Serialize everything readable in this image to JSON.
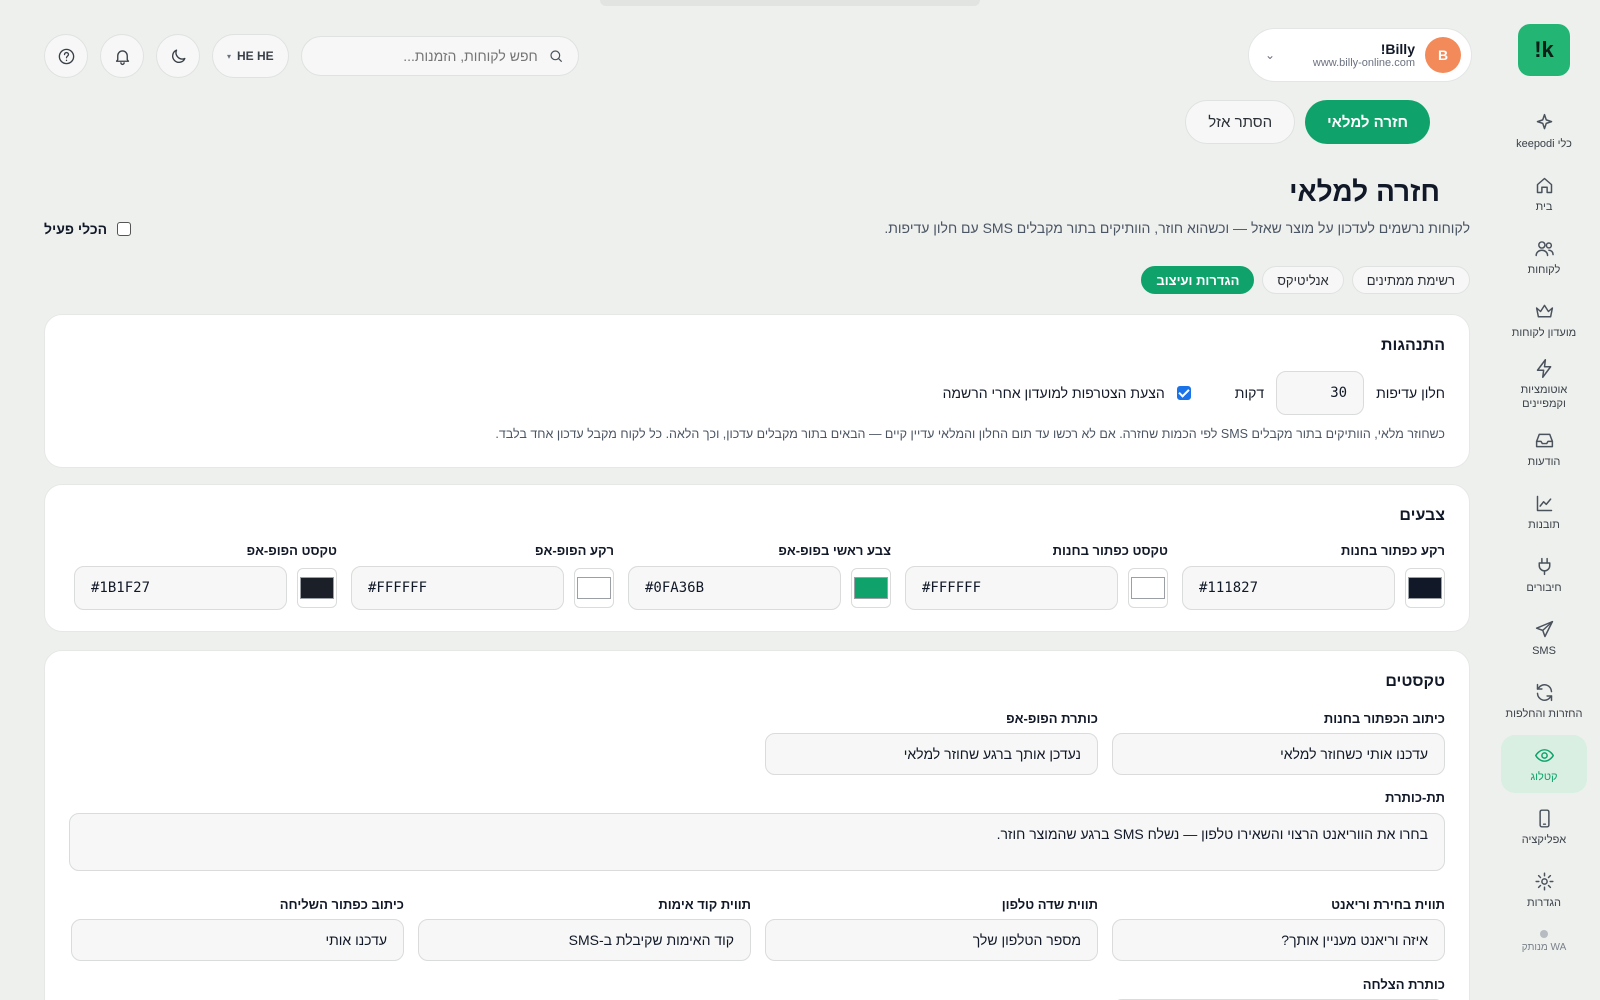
{
  "brand": {
    "logo_text": "!k"
  },
  "sidebar": {
    "items": [
      {
        "label": "כלי keepodi",
        "icon": "sparkle-icon"
      },
      {
        "label": "בית",
        "icon": "home-icon"
      },
      {
        "label": "לקוחות",
        "icon": "users-icon"
      },
      {
        "label": "מועדון לקוחות",
        "icon": "crown-icon"
      },
      {
        "label": "אוטומציות וקמפיינים",
        "icon": "lightning-icon"
      },
      {
        "label": "הודעות",
        "icon": "inbox-icon"
      },
      {
        "label": "תובנות",
        "icon": "chart-icon"
      },
      {
        "label": "חיבורים",
        "icon": "plug-icon"
      },
      {
        "label": "SMS",
        "icon": "send-icon"
      },
      {
        "label": "החזרות והחלפות",
        "icon": "refresh-icon"
      },
      {
        "label": "קטלוג",
        "icon": "eye-icon",
        "active": true
      },
      {
        "label": "אפליקציה",
        "icon": "phone-icon"
      },
      {
        "label": "הגדרות",
        "icon": "gear-icon"
      }
    ],
    "wa_status": "WA מנותק"
  },
  "account": {
    "initial": "B",
    "name": "Billy!",
    "url": "www.billy-online.com"
  },
  "search": {
    "placeholder": "חפש לקוחות, הזמנות..."
  },
  "language": {
    "label": "HE HE"
  },
  "actions": {
    "primary": "חזרה למלאי",
    "secondary": "הסתר אזל"
  },
  "page": {
    "title": "חזרה למלאי",
    "description": "לקוחות נרשמים לעדכון על מוצר שאזל — וכשהוא חוזר, הוותיקים בתור מקבלים SMS עם חלון עדיפות.",
    "tool_active_label": "הכלי פעיל",
    "tool_active_checked": false
  },
  "tabs": [
    {
      "label": "רשימת ממתינים",
      "active": false
    },
    {
      "label": "אנליטיקס",
      "active": false
    },
    {
      "label": "הגדרות ועיצוב",
      "active": true
    }
  ],
  "behaviors": {
    "title": "התנהגות",
    "priority_window_label": "חלון עדיפות",
    "priority_window_value": "30",
    "minutes_label": "דקות",
    "club_offer_label": "הצעת הצטרפות למועדון אחרי הרשמה",
    "club_offer_checked": true,
    "note": "כשחוזר מלאי, הוותיקים בתור מקבלים SMS לפי הכמות שחזרה. אם לא רכשו עד תום החלון והמלאי עדיין קיים — הבאים בתור מקבלים עדכון, וכך הלאה. כל לקוח מקבל עדכון אחד בלבד."
  },
  "colors": {
    "title": "צבעים",
    "fields": [
      {
        "label": "רקע כפתור בחנות",
        "value": "#111827",
        "swatch": "#111827"
      },
      {
        "label": "טקסט כפתור בחנות",
        "value": "#FFFFFF",
        "swatch": "#FFFFFF"
      },
      {
        "label": "צבע ראשי בפופ-אפ",
        "value": "#0FA36B",
        "swatch": "#0FA36B"
      },
      {
        "label": "רקע הפופ-אפ",
        "value": "#FFFFFF",
        "swatch": "#FFFFFF"
      },
      {
        "label": "טקסט הפופ-אפ",
        "value": "#1B1F27",
        "swatch": "#1B1F27"
      }
    ]
  },
  "texts": {
    "title": "טקסטים",
    "store_button_label": "כיתוב הכפתור בחנות",
    "store_button_value": "עדכנו אותי כשחוזר למלאי",
    "popup_title_label": "כותרת הפופ-אפ",
    "popup_title_value": "נעדכן אותך ברגע שחוזר למלאי",
    "subtitle_label": "תת-כותרת",
    "subtitle_value": "בחרו את הווריאנט הרצוי והשאירו טלפון — נשלח SMS ברגע שהמוצר חוזר.",
    "variant_label": "תווית בחירת וריאנט",
    "variant_value": "איזה וריאנט מעניין אותך?",
    "phone_label": "תווית שדה טלפון",
    "phone_value": "מספר הטלפון שלך",
    "code_label": "תווית קוד אימות",
    "code_value": "קוד האימות שקיבלת ב-SMS",
    "submit_label": "כיתוב כפתור השליחה",
    "submit_value": "עדכנו אותי",
    "success_title_label": "כותרת הצלחה"
  }
}
